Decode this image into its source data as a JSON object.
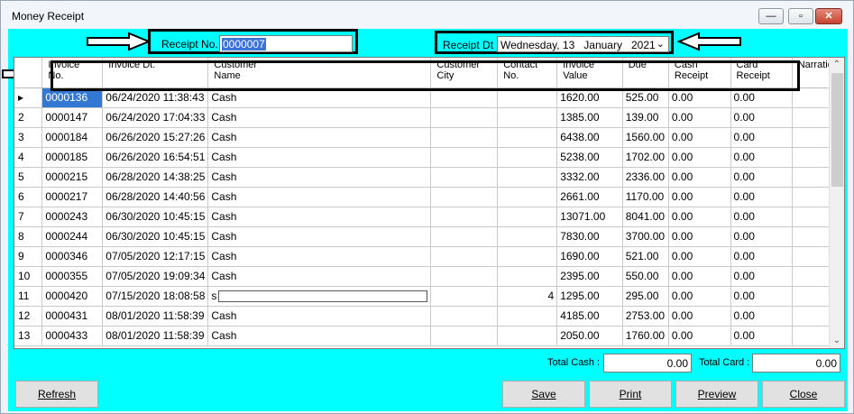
{
  "window": {
    "title": "Money Receipt",
    "min": "—",
    "max": "▫",
    "close": "✕"
  },
  "receipt_no": {
    "label": "Receipt No. :",
    "value": "0000007"
  },
  "receipt_dt": {
    "label": "Receipt Dt :",
    "value": "Wednesday, 13   January   2021"
  },
  "grid": {
    "columns": [
      [
        "Invoice",
        "No."
      ],
      [
        "Invoice Dt.",
        ""
      ],
      [
        "Customer",
        "Name"
      ],
      [
        "Customer",
        "City"
      ],
      [
        "Contact",
        "No."
      ],
      [
        "Invoice",
        "Value"
      ],
      [
        "Due",
        ""
      ],
      [
        "Cash",
        "Receipt"
      ],
      [
        "Card",
        "Receipt"
      ],
      [
        "Narration",
        ""
      ]
    ],
    "rows": [
      {
        "n": "",
        "inv": "0000136",
        "dt": "06/24/2020 11:38:43",
        "name": "Cash",
        "city": "",
        "contact": "",
        "val": "1620.00",
        "due": "525.00",
        "cash": "0.00",
        "card": "0.00",
        "narr": ""
      },
      {
        "n": "2",
        "inv": "0000147",
        "dt": "06/24/2020 17:04:33",
        "name": "Cash",
        "city": "",
        "contact": "",
        "val": "1385.00",
        "due": "139.00",
        "cash": "0.00",
        "card": "0.00",
        "narr": ""
      },
      {
        "n": "3",
        "inv": "0000184",
        "dt": "06/26/2020 15:27:26",
        "name": "Cash",
        "city": "",
        "contact": "",
        "val": "6438.00",
        "due": "1560.00",
        "cash": "0.00",
        "card": "0.00",
        "narr": ""
      },
      {
        "n": "4",
        "inv": "0000185",
        "dt": "06/26/2020 16:54:51",
        "name": "Cash",
        "city": "",
        "contact": "",
        "val": "5238.00",
        "due": "1702.00",
        "cash": "0.00",
        "card": "0.00",
        "narr": ""
      },
      {
        "n": "5",
        "inv": "0000215",
        "dt": "06/28/2020 14:38:25",
        "name": "Cash",
        "city": "",
        "contact": "",
        "val": "3332.00",
        "due": "2336.00",
        "cash": "0.00",
        "card": "0.00",
        "narr": ""
      },
      {
        "n": "6",
        "inv": "0000217",
        "dt": "06/28/2020 14:40:56",
        "name": "Cash",
        "city": "",
        "contact": "",
        "val": "2661.00",
        "due": "1170.00",
        "cash": "0.00",
        "card": "0.00",
        "narr": ""
      },
      {
        "n": "7",
        "inv": "0000243",
        "dt": "06/30/2020 10:45:15",
        "name": "Cash",
        "city": "",
        "contact": "",
        "val": "13071.00",
        "due": "8041.00",
        "cash": "0.00",
        "card": "0.00",
        "narr": ""
      },
      {
        "n": "8",
        "inv": "0000244",
        "dt": "06/30/2020 10:45:15",
        "name": "Cash",
        "city": "",
        "contact": "",
        "val": "7830.00",
        "due": "3700.00",
        "cash": "0.00",
        "card": "0.00",
        "narr": ""
      },
      {
        "n": "9",
        "inv": "0000346",
        "dt": "07/05/2020 12:17:15",
        "name": "Cash",
        "city": "",
        "contact": "",
        "val": "1690.00",
        "due": "521.00",
        "cash": "0.00",
        "card": "0.00",
        "narr": ""
      },
      {
        "n": "10",
        "inv": "0000355",
        "dt": "07/05/2020 19:09:34",
        "name": "Cash",
        "city": "",
        "contact": "",
        "val": "2395.00",
        "due": "550.00",
        "cash": "0.00",
        "card": "0.00",
        "narr": ""
      },
      {
        "n": "11",
        "inv": "0000420",
        "dt": "07/15/2020 18:08:58",
        "name": "s",
        "city": "",
        "contact": "4",
        "val": "1295.00",
        "due": "295.00",
        "cash": "0.00",
        "card": "0.00",
        "narr": ""
      },
      {
        "n": "12",
        "inv": "0000431",
        "dt": "08/01/2020 11:58:39",
        "name": "Cash",
        "city": "",
        "contact": "",
        "val": "4185.00",
        "due": "2753.00",
        "cash": "0.00",
        "card": "0.00",
        "narr": ""
      },
      {
        "n": "13",
        "inv": "0000433",
        "dt": "08/01/2020 11:58:39",
        "name": "Cash",
        "city": "",
        "contact": "",
        "val": "2050.00",
        "due": "1760.00",
        "cash": "0.00",
        "card": "0.00",
        "narr": ""
      }
    ]
  },
  "totals": {
    "cash_label": "Total Cash :",
    "cash_value": "0.00",
    "card_label": "Total Card :",
    "card_value": "0.00"
  },
  "buttons": {
    "refresh": "Refresh",
    "save": "Save",
    "print": "Print",
    "preview": "Preview",
    "close": "Close"
  },
  "icons": {
    "current_row": "row-pointer-icon",
    "scroll_up": "scroll-up-icon",
    "scroll_down": "scroll-down-icon",
    "dropdown": "chevron-down-icon"
  },
  "colors": {
    "client_bg": "#00ffff",
    "selection": "#3379d4"
  }
}
